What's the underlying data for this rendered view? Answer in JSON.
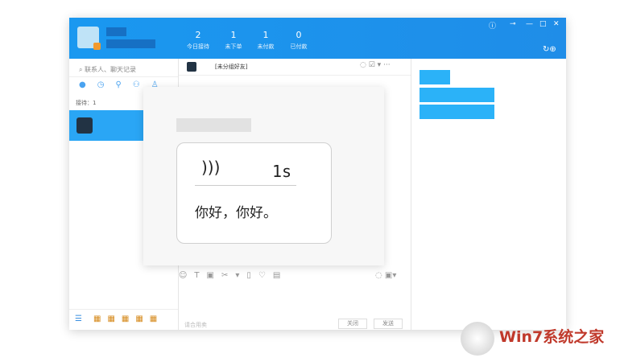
{
  "stats": [
    {
      "value": "2",
      "label": "今日接待"
    },
    {
      "value": "1",
      "label": "未下单"
    },
    {
      "value": "1",
      "label": "未付款"
    },
    {
      "value": "0",
      "label": "已付款"
    }
  ],
  "search": {
    "placeholder": "联系人、聊天记录"
  },
  "chat": {
    "group": "[未分组好友]"
  },
  "reception": "接待：1",
  "dialog": {
    "duration": "1s",
    "message": "你好，你好。"
  },
  "input": {
    "hint": "请合用卖",
    "close": "关闭",
    "send": "发送"
  },
  "watermark": {
    "brand": "Win7系统之家"
  }
}
